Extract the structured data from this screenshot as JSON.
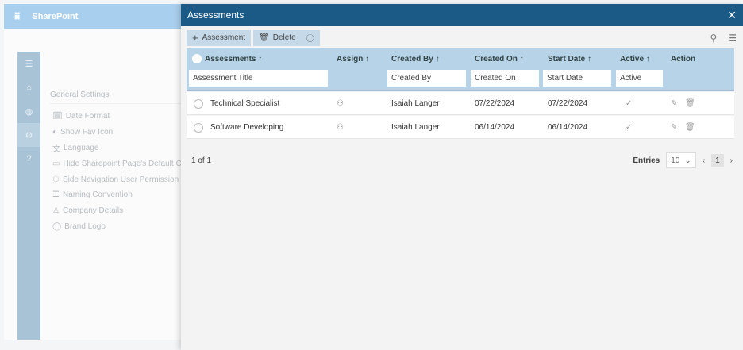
{
  "app": {
    "title": "SharePoint"
  },
  "rail": [
    "menu-icon",
    "home-icon",
    "globe-icon",
    "gear-icon",
    "help-icon"
  ],
  "settings": {
    "heading": "General Settings",
    "items": [
      {
        "label": "Date Format",
        "icon": "🗓"
      },
      {
        "label": "Show Fav Icon",
        "icon": "◐"
      },
      {
        "label": "Language",
        "icon": "文"
      },
      {
        "label": "Hide Sharepoint Page's Default Co",
        "icon": "▭"
      },
      {
        "label": "Side Navigation User Permission",
        "icon": "⚇"
      },
      {
        "label": "Naming Convention",
        "icon": "☰"
      },
      {
        "label": "Company Details",
        "icon": "♙"
      },
      {
        "label": "Brand Logo",
        "icon": "◯"
      }
    ]
  },
  "panel": {
    "title": "Assessments",
    "close": "✕"
  },
  "toolbar": {
    "add": "Assessment",
    "delete": "Delete"
  },
  "table": {
    "columns": [
      "Assessments ↑",
      "Assign ↑",
      "Created By ↑",
      "Created On ↑",
      "Start Date ↑",
      "Active ↑",
      "Action"
    ],
    "filters": {
      "title": "Assessment Title",
      "created_by": "Created By",
      "created_on": "Created On",
      "start_date": "Start Date",
      "active": "Active"
    },
    "rows": [
      {
        "title": "Technical Specialist",
        "created_by": "Isaiah Langer",
        "created_on": "07/22/2024",
        "start_date": "07/22/2024",
        "active": "✓"
      },
      {
        "title": "Software Developing",
        "created_by": "Isaiah Langer",
        "created_on": "06/14/2024",
        "start_date": "06/14/2024",
        "active": "✓"
      }
    ]
  },
  "footer": {
    "page_info": "1 of 1",
    "entries_label": "Entries",
    "entries_value": "10",
    "current_page": "1"
  },
  "colors": {
    "header": "#1b5a86",
    "table_header": "#b7d3e8",
    "topbar": "#a9cfee"
  }
}
